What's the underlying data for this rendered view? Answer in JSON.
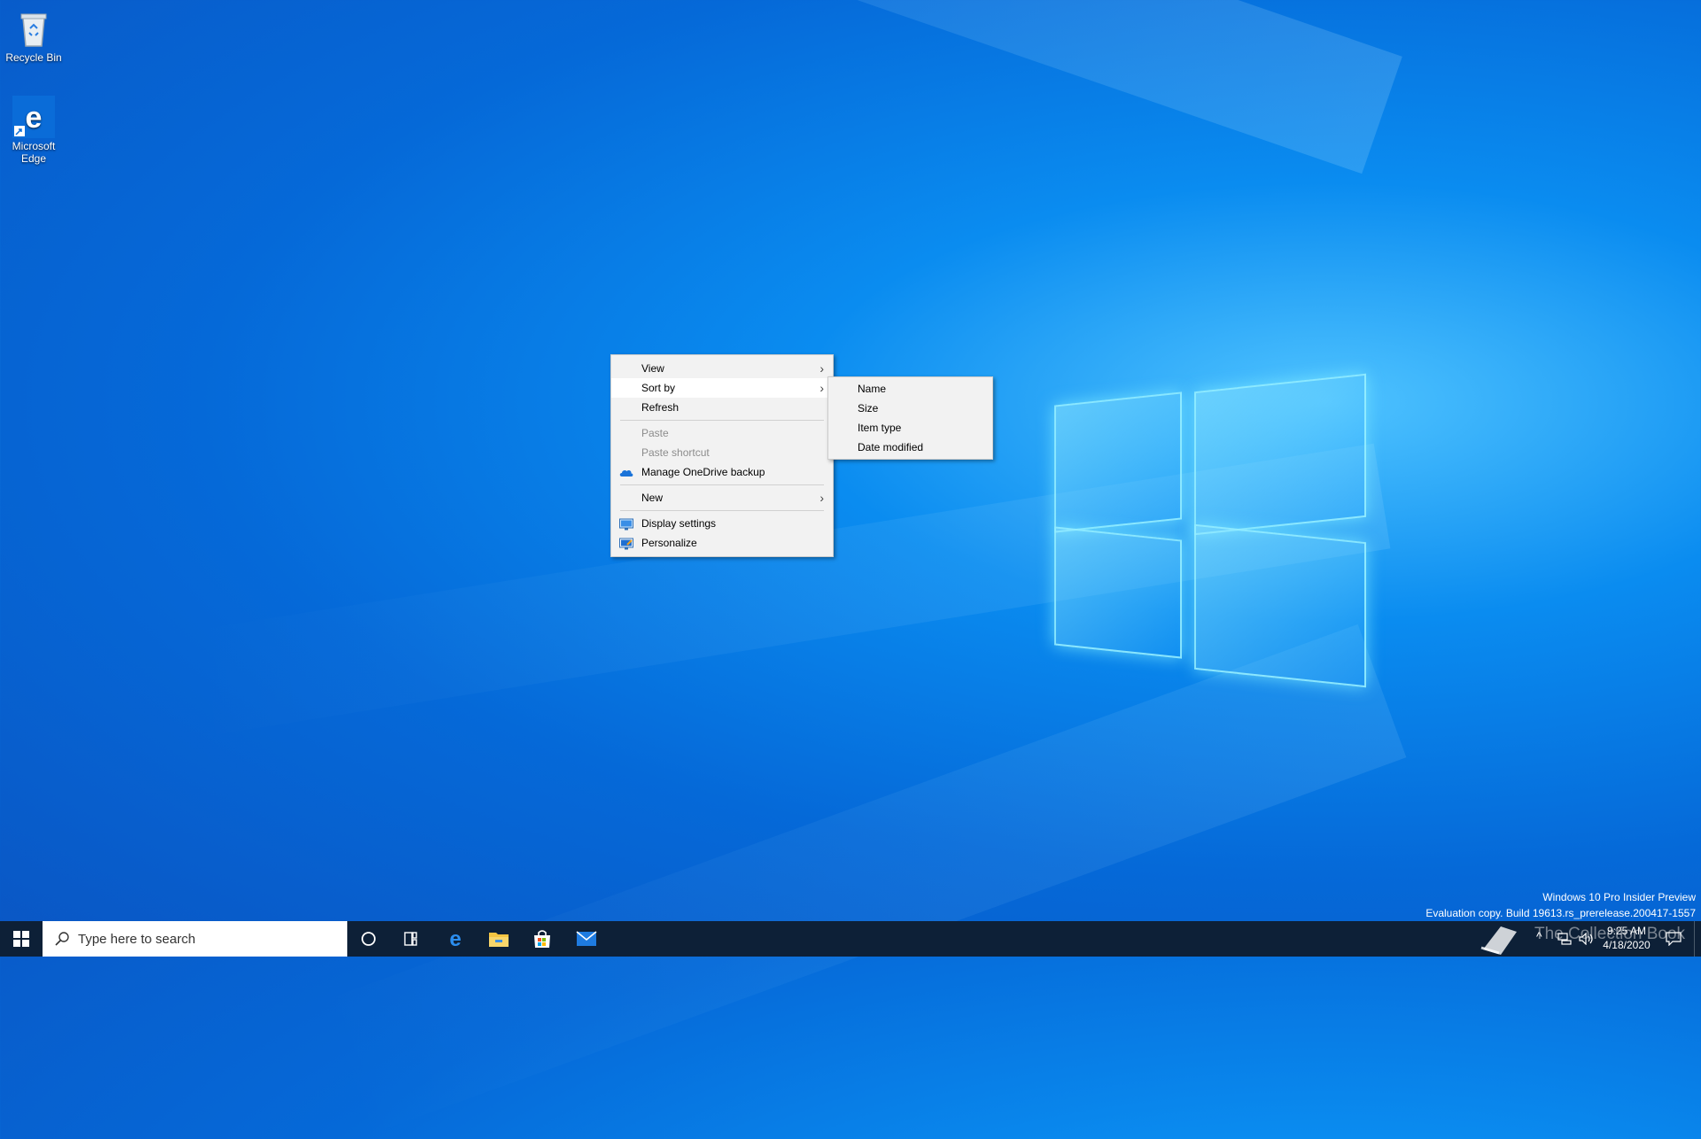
{
  "desktop": {
    "icons": [
      {
        "label": "Recycle Bin",
        "icon": "recycle-bin-icon"
      },
      {
        "label": "Microsoft Edge",
        "icon": "edge-icon"
      }
    ]
  },
  "context_menu": {
    "items": [
      {
        "label": "View",
        "submenu": true
      },
      {
        "label": "Sort by",
        "submenu": true,
        "highlighted": true
      },
      {
        "label": "Refresh"
      },
      {
        "label": "Paste",
        "disabled": true
      },
      {
        "label": "Paste shortcut",
        "disabled": true
      },
      {
        "label": "Manage OneDrive backup",
        "icon": "onedrive-icon"
      },
      {
        "label": "New",
        "submenu": true
      },
      {
        "label": "Display settings",
        "icon": "display-icon"
      },
      {
        "label": "Personalize",
        "icon": "personalize-icon"
      }
    ]
  },
  "sort_submenu": {
    "items": [
      "Name",
      "Size",
      "Item type",
      "Date modified"
    ]
  },
  "taskbar": {
    "search_placeholder": "Type here to search",
    "pinned": [
      "cortana-icon",
      "task-view-icon",
      "edge-icon",
      "file-explorer-icon",
      "store-icon",
      "mail-icon"
    ],
    "clock_time": "9:25 AM",
    "clock_date": "4/18/2020"
  },
  "watermark": {
    "line1": "Windows 10 Pro Insider Preview",
    "line2": "Evaluation copy. Build 19613.rs_prerelease.200417-1557",
    "brand": "The Collection Book"
  },
  "colors": {
    "taskbar": "#0d2037",
    "menu_bg": "#f2f2f2",
    "accent_blue": "#0078d7"
  }
}
